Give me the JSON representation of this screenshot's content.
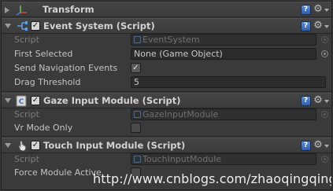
{
  "transform": {
    "title": "Transform",
    "icon": "transform-axes-icon"
  },
  "event_system": {
    "title": "Event System (Script)",
    "icon": "event-system-icon",
    "enabled": true,
    "fields": {
      "script_label": "Script",
      "script_value": "EventSystem",
      "first_selected_label": "First Selected",
      "first_selected_value": "None (Game Object)",
      "send_nav_label": "Send Navigation Events",
      "send_nav_value": true,
      "drag_threshold_label": "Drag Threshold",
      "drag_threshold_value": "5"
    }
  },
  "gaze_input": {
    "title": "Gaze Input Module (Script)",
    "icon": "gaze-module-icon",
    "enabled": true,
    "fields": {
      "script_label": "Script",
      "script_value": "GazeInputModule",
      "vr_mode_label": "Vr Mode Only",
      "vr_mode_value": false
    }
  },
  "touch_input": {
    "title": "Touch Input Module (Script)",
    "icon": "touch-hand-icon",
    "enabled": true,
    "fields": {
      "script_label": "Script",
      "script_value": "TouchInputModule",
      "force_label": "Force Module Active",
      "force_value": false
    }
  },
  "watermark": "http://www.cnblogs.com/zhaoqingqing/",
  "colors": {
    "background": "#383838",
    "header": "#404040",
    "help_blue": "#3f72c2"
  }
}
